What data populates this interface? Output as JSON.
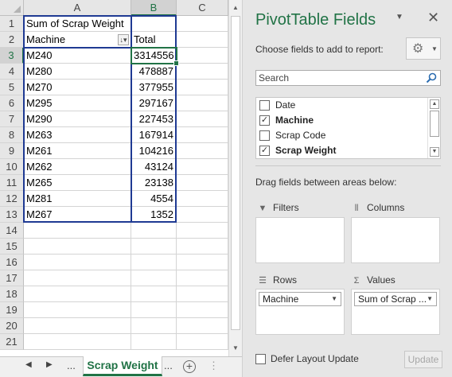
{
  "sheet": {
    "columns": [
      "A",
      "B",
      "C"
    ],
    "rows": [
      "1",
      "2",
      "3",
      "4",
      "5",
      "6",
      "7",
      "8",
      "9",
      "10",
      "11",
      "12",
      "13",
      "14",
      "15",
      "16",
      "17",
      "18",
      "19",
      "20",
      "21"
    ],
    "pivot": {
      "title": "Sum of Scrap Weight",
      "header_label": "Machine",
      "total_label": "Total",
      "data": [
        {
          "machine": "M240",
          "total": "3314556"
        },
        {
          "machine": "M280",
          "total": "478887"
        },
        {
          "machine": "M270",
          "total": "377955"
        },
        {
          "machine": "M295",
          "total": "297167"
        },
        {
          "machine": "M290",
          "total": "227453"
        },
        {
          "machine": "M263",
          "total": "167914"
        },
        {
          "machine": "M261",
          "total": "104216"
        },
        {
          "machine": "M262",
          "total": "43124"
        },
        {
          "machine": "M265",
          "total": "23138"
        },
        {
          "machine": "M281",
          "total": "4554"
        },
        {
          "machine": "M267",
          "total": "1352"
        }
      ]
    },
    "active_cell": "B3",
    "tabs": {
      "active": "Scrap Weight",
      "ellipsis": "...",
      "add": "+"
    }
  },
  "pane": {
    "title": "PivotTable Fields",
    "choose_label": "Choose fields to add to report:",
    "search_placeholder": "Search",
    "fields": [
      {
        "label": "Date",
        "checked": false,
        "mark": ""
      },
      {
        "label": "Machine",
        "checked": true,
        "mark": "✓"
      },
      {
        "label": "Scrap Code",
        "checked": false,
        "mark": ""
      },
      {
        "label": "Scrap Weight",
        "checked": true,
        "mark": "✓"
      }
    ],
    "drag_label": "Drag fields between areas below:",
    "areas": {
      "filters": "Filters",
      "columns": "Columns",
      "rows": "Rows",
      "values": "Values",
      "rows_item": "Machine",
      "values_item": "Sum of Scrap ..."
    },
    "defer_label": "Defer Layout Update",
    "update_label": "Update"
  },
  "colors": {
    "accent": "#217346",
    "pivot_border": "#1f3a93"
  }
}
